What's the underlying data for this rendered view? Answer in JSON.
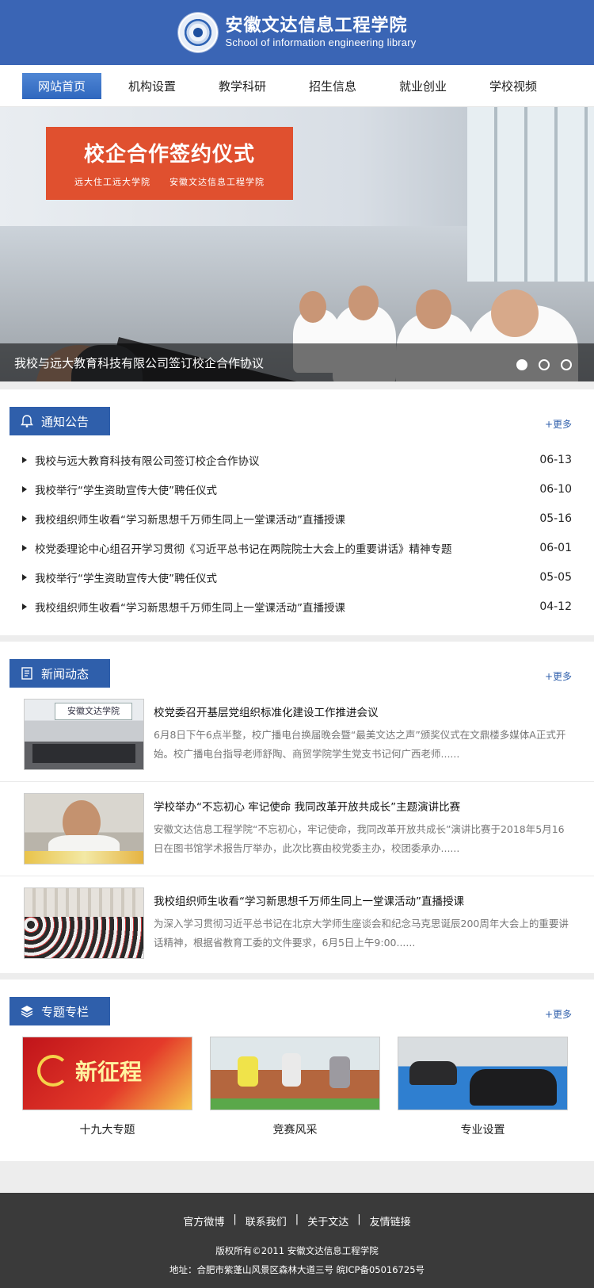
{
  "header": {
    "title_cn": "安徽文达信息工程学院",
    "title_en": "School of information engineering library"
  },
  "nav": [
    {
      "label": "网站首页",
      "active": true
    },
    {
      "label": "机构设置"
    },
    {
      "label": "教学科研"
    },
    {
      "label": "招生信息"
    },
    {
      "label": "就业创业"
    },
    {
      "label": "学校视频"
    }
  ],
  "banner": {
    "sign_title": "校企合作签约仪式",
    "sign_sub": "远大住工远大学院　　安徽文达信息工程学院",
    "caption": "我校与远大教育科技有限公司签订校企合作协议",
    "slides_total": 3,
    "current_slide": 1
  },
  "notice": {
    "title": "通知公告",
    "more": "+更多",
    "items": [
      {
        "title": "我校与远大教育科技有限公司签订校企合作协议",
        "date": "06-13"
      },
      {
        "title": "我校举行“学生资助宣传大使”聘任仪式",
        "date": "06-10"
      },
      {
        "title": "我校组织师生收看“学习新思想千万师生同上一堂课活动”直播授课",
        "date": "05-16"
      },
      {
        "title": "校党委理论中心组召开学习贯彻《习近平总书记在两院院士大会上的重要讲话》精神专题",
        "date": "06-01"
      },
      {
        "title": "我校举行“学生资助宣传大使”聘任仪式",
        "date": "05-05"
      },
      {
        "title": "我校组织师生收看“学习新思想千万师生同上一堂课活动”直播授课",
        "date": "04-12"
      }
    ]
  },
  "news": {
    "title": "新闻动态",
    "more": "+更多",
    "items": [
      {
        "title": "校党委召开基层党组织标准化建设工作推进会议",
        "desc": "6月8日下午6点半整，校广播电台换届晚会暨“最美文达之声”颁奖仪式在文鼎楼多媒体A正式开始。校广播电台指导老师舒陶、商贸学院学生党支书记何广西老师......"
      },
      {
        "title": "学校举办“不忘初心 牢记使命 我同改革开放共成长”主题演讲比赛",
        "desc": "安徽文达信息工程学院“不忘初心，牢记使命，我同改革开放共成长”演讲比赛于2018年5月16日在图书馆学术报告厅举办，此次比赛由校党委主办，校团委承办......"
      },
      {
        "title": "我校组织师生收看“学习新思想千万师生同上一堂课活动”直播授课",
        "desc": "为深入学习贯彻习近平总书记在北京大学师生座谈会和纪念马克思诞辰200周年大会上的重要讲话精神，根据省教育工委的文件要求，6月5日上午9:00......"
      }
    ],
    "thumb1_text": "安徽文达学院"
  },
  "topics": {
    "title": "专题专栏",
    "more": "+更多",
    "items": [
      {
        "label": "十九大专题",
        "img_text": "新征程"
      },
      {
        "label": "竞赛风采"
      },
      {
        "label": "专业设置"
      }
    ]
  },
  "footer": {
    "links": [
      "官方微博",
      "联系我们",
      "关于文达",
      "友情链接"
    ],
    "copyright": "版权所有©2011 安徽文达信息工程学院",
    "address": "地址：合肥市紫蓬山风景区森林大道三号 皖ICP备05016725号"
  },
  "colors": {
    "brand_blue": "#3a65b5",
    "tab_blue": "#2f5fab",
    "footer_bg": "#3a3a3a"
  }
}
